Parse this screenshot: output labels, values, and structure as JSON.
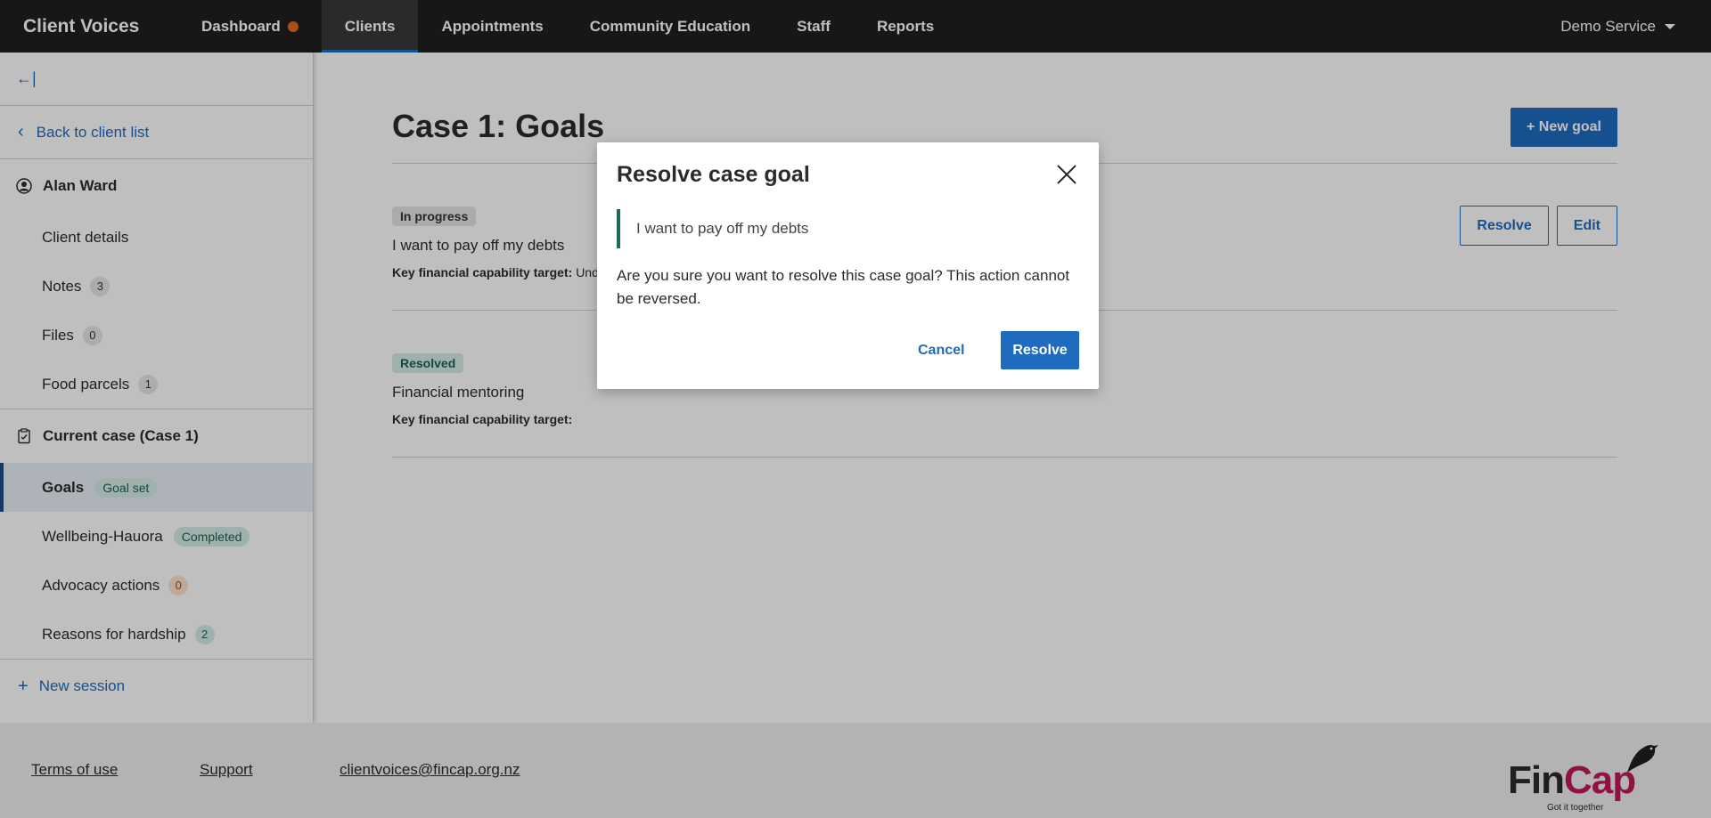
{
  "app": {
    "brand": "Client Voices"
  },
  "nav": {
    "items": [
      {
        "label": "Dashboard"
      },
      {
        "label": "Clients"
      },
      {
        "label": "Appointments"
      },
      {
        "label": "Community Education"
      },
      {
        "label": "Staff"
      },
      {
        "label": "Reports"
      }
    ],
    "service": "Demo Service"
  },
  "sidebar": {
    "collapse_glyph": "←|",
    "back_label": "Back to client list",
    "client_name": "Alan Ward",
    "client_items": [
      {
        "label": "Client details"
      },
      {
        "label": "Notes",
        "count": "3"
      },
      {
        "label": "Files",
        "count": "0"
      },
      {
        "label": "Food parcels",
        "count": "1"
      }
    ],
    "case_heading": "Current case (Case 1)",
    "case_items": [
      {
        "label": "Goals",
        "tag": "Goal set"
      },
      {
        "label": "Wellbeing-Hauora",
        "tag": "Completed"
      },
      {
        "label": "Advocacy actions",
        "count": "0"
      },
      {
        "label": "Reasons for hardship",
        "count": "2"
      }
    ],
    "new_session": "New session"
  },
  "main": {
    "title": "Case 1: Goals",
    "new_goal": "+ New goal",
    "goals": [
      {
        "status": "In progress",
        "title": "I want to pay off my debts",
        "target_label": "Key financial capability target:",
        "target_value": "Und",
        "resolve": "Resolve",
        "edit": "Edit"
      },
      {
        "status": "Resolved",
        "title": "Financial mentoring",
        "target_label": "Key financial capability target:",
        "target_value": ""
      }
    ]
  },
  "footer": {
    "terms": "Terms of use",
    "support": "Support",
    "email": "clientvoices@fincap.org.nz",
    "logo_fin": "Fin",
    "logo_cap": "Cap",
    "logo_tagline": "Got it together"
  },
  "modal": {
    "title": "Resolve case goal",
    "quote": "I want to pay off my debts",
    "text": "Are you sure you want to resolve this case goal? This action cannot be reversed.",
    "cancel": "Cancel",
    "resolve": "Resolve"
  },
  "colors": {
    "nav_bg": "#1f1f1f",
    "primary": "#1e6bbf",
    "accent_dot": "#e66a1f",
    "teal": "#1d6b5b",
    "logo_magenta": "#c1185a"
  }
}
